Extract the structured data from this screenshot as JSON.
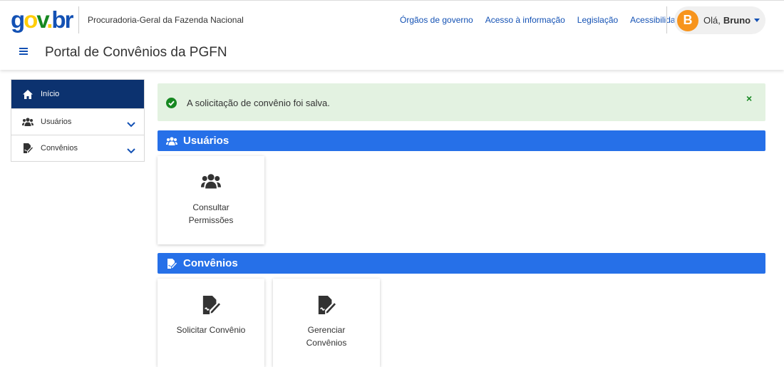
{
  "header": {
    "logo": {
      "g": "g",
      "o": "o",
      "v": "v",
      "dot": ".",
      "b": "b",
      "r": "r"
    },
    "org_name": "Procuradoria-Geral da Fazenda Nacional",
    "links": [
      "Órgãos de governo",
      "Acesso à informação",
      "Legislação",
      "Acessibilidade"
    ],
    "user": {
      "initial": "B",
      "greeting": "Olá,",
      "name": "Bruno"
    },
    "portal_title": "Portal de Convênios da PGFN"
  },
  "sidebar": {
    "items": [
      {
        "label": "Início",
        "icon": "home-icon",
        "active": true
      },
      {
        "label": "Usuários",
        "icon": "users-icon",
        "expandable": true
      },
      {
        "label": "Convênios",
        "icon": "signature-icon",
        "expandable": true
      }
    ]
  },
  "alert": {
    "message": "A solicitação de convênio foi salva.",
    "close": "×"
  },
  "sections": [
    {
      "title": "Usuários",
      "icon": "users-icon",
      "cards": [
        {
          "line1": "Consultar",
          "line2": "Permissões",
          "icon": "users-icon"
        }
      ]
    },
    {
      "title": "Convênios",
      "icon": "signature-icon",
      "cards": [
        {
          "line1": "Solicitar Convênio",
          "line2": "",
          "icon": "signature-icon"
        },
        {
          "line1": "Gerenciar",
          "line2": "Convênios",
          "icon": "signature-icon"
        }
      ]
    }
  ],
  "colors": {
    "primary_blue": "#1351b4",
    "nav_active": "#0c326f",
    "section_bar": "#2670e8",
    "success_bg": "#e3f2e1",
    "success_green": "#168821",
    "avatar_orange": "#f7941d"
  }
}
